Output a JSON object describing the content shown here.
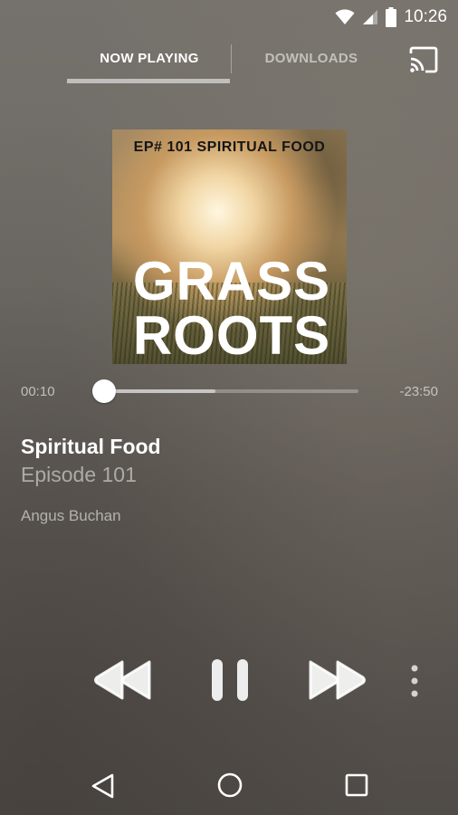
{
  "status_bar": {
    "time": "10:26",
    "icons": [
      "wifi-icon",
      "cellular-signal-icon",
      "battery-icon"
    ]
  },
  "tabs": [
    {
      "label": "NOW PLAYING",
      "selected": true
    },
    {
      "label": "DOWNLOADS",
      "selected": false
    }
  ],
  "cast_icon": "cast-icon",
  "artwork": {
    "episode_label": "EP# 101 SPIRITUAL FOOD",
    "line1": "GRASS",
    "line2": "ROOTS"
  },
  "progress": {
    "elapsed": "00:10",
    "remaining": "-23:50",
    "played_fraction": 0.007,
    "buffered_fraction": 0.44
  },
  "track": {
    "title": "Spiritual Food",
    "episode": "Episode 101",
    "author": "Angus Buchan"
  },
  "controls": [
    "rewind-icon",
    "pause-icon",
    "fast-forward-icon",
    "more-vert-icon"
  ],
  "nav_bar": [
    "back-icon",
    "home-icon",
    "recents-icon"
  ],
  "colors": {
    "background": "#6e6a65",
    "text_primary": "#ffffff"
  }
}
